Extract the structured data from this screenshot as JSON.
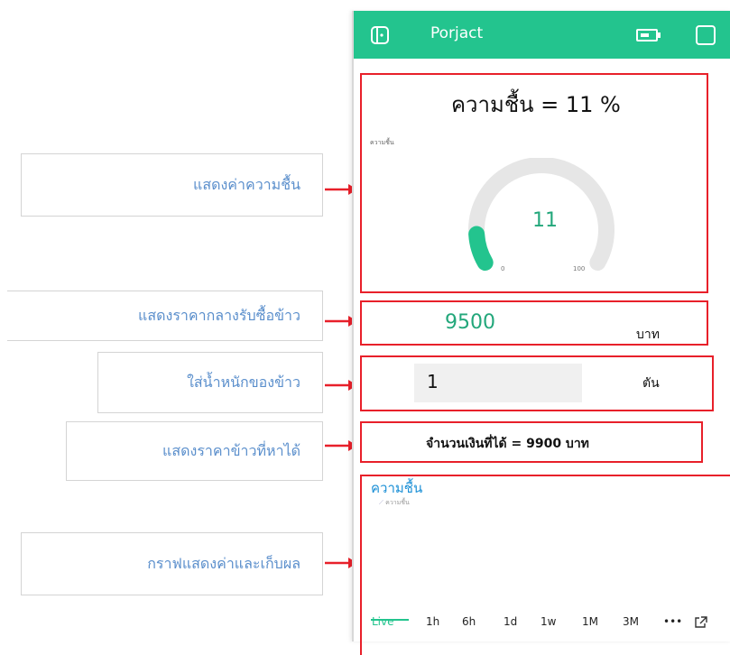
{
  "annotations": [
    {
      "label": "แสดงค่าความชื้น"
    },
    {
      "label": "แสดงราคากลางรับซื้อข้าว"
    },
    {
      "label": "ใส่น้ำหนักของข้าว"
    },
    {
      "label": "แสดงราคาข้าวที่หาได้"
    },
    {
      "label": "กราฟแสดงค่าและเก็บผล"
    }
  ],
  "app": {
    "title": "Porjact",
    "accent": "#23c48e",
    "icons": [
      "device-icon",
      "battery-icon",
      "square-icon"
    ]
  },
  "gauge": {
    "heading": "ความชื้น = 11 %",
    "caption": "ความชื้น",
    "value": "11",
    "min": "0",
    "max": "100",
    "fraction": 0.11,
    "color": "#23c48e"
  },
  "price": {
    "value": "9500",
    "unit": "บาท"
  },
  "weight": {
    "value": "1",
    "unit": "ตัน"
  },
  "result": {
    "text": "จำนวนเงินที่ได้ = 9900 บาท"
  },
  "chart": {
    "title": "ความชื้น",
    "legend": "ความชื้น",
    "tabs": [
      "Live",
      "1h",
      "6h",
      "1d",
      "1w",
      "1M",
      "3M",
      "•••"
    ],
    "active_tab": "Live"
  }
}
